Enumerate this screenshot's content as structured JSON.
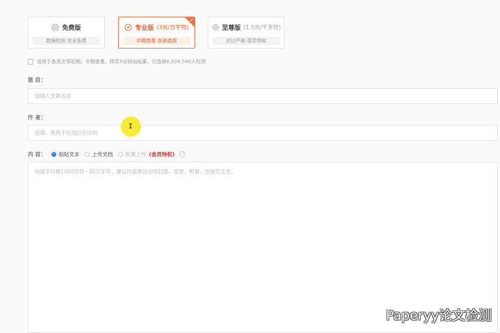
{
  "plans": [
    {
      "name": "免费版",
      "price": "",
      "desc": "数据检测 完全免费",
      "icon": "target-icon",
      "selected": false
    },
    {
      "name": "专业版",
      "price": "(3元/万字符)",
      "desc": "中期查重 本纳选用",
      "icon": "compass-icon",
      "selected": true
    },
    {
      "name": "至尊版",
      "price": "(1.5元/千字符)",
      "desc": "对比严格 尊享特权",
      "icon": "settings-icon",
      "selected": false
    }
  ],
  "notice": "适用于各类文章初期，中期查重，特享5分钟出结果，已连续6,539,546人检测",
  "title_field": {
    "label": "题 目：",
    "placeholder": "请输入文章名称"
  },
  "author_field": {
    "label": "作 者：",
    "placeholder": "选填，用用于检测白引比例"
  },
  "content": {
    "label": "内 容：",
    "options": [
      "粘贴文本",
      "上传文档",
      "批量上传"
    ],
    "member_label": "(会员特权)",
    "placeholder": "内容字符数1000字符~30万字符，建议内容建议去除封面，目录，附录，仅提交正文。"
  },
  "watermark": "Paperyy论文检测",
  "colors": {
    "accent": "#e8744a",
    "radio_active": "#2f7df0",
    "member": "#d0312d"
  }
}
